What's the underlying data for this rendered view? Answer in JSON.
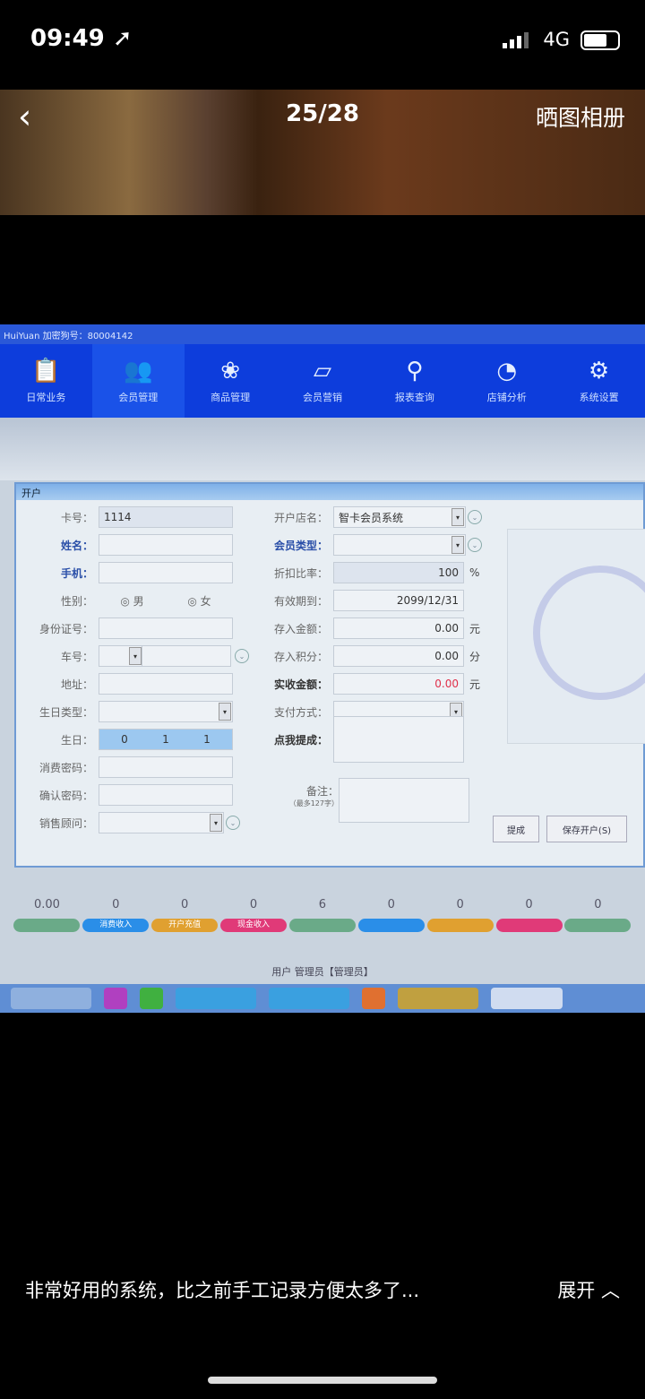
{
  "status_bar": {
    "time": "09:49",
    "network": "4G",
    "location_icon": "location-arrow-icon"
  },
  "viewer": {
    "counter": "25/28",
    "album_label": "晒图相册",
    "back_icon": "chevron-left-icon"
  },
  "app": {
    "title": "HuiYuan  加密狗号：80004142",
    "toolbar": [
      {
        "label": "日常业务",
        "icon": "clipboard-chart-icon"
      },
      {
        "label": "会员管理",
        "icon": "users-icon",
        "active": true
      },
      {
        "label": "商品管理",
        "icon": "cubes-icon"
      },
      {
        "label": "会员营销",
        "icon": "phone-icon"
      },
      {
        "label": "报表查询",
        "icon": "search-chart-icon"
      },
      {
        "label": "店铺分析",
        "icon": "pie-chart-icon"
      },
      {
        "label": "系统设置",
        "icon": "gear-icon"
      }
    ],
    "dialog": {
      "title": "开户",
      "left": {
        "card_no": {
          "label": "卡号：",
          "value": "1114"
        },
        "name": {
          "label": "姓名：",
          "value": ""
        },
        "mobile": {
          "label": "手机：",
          "value": ""
        },
        "gender": {
          "label": "性别：",
          "options": [
            "男",
            "女"
          ]
        },
        "id_no": {
          "label": "身份证号："
        },
        "car_no": {
          "label": "车号："
        },
        "address": {
          "label": "地址："
        },
        "birthday_type": {
          "label": "生日类型："
        },
        "birthday": {
          "label": "生日：",
          "values": [
            "0",
            "1",
            "1"
          ]
        },
        "pay_pwd": {
          "label": "消费密码："
        },
        "confirm_pwd": {
          "label": "确认密码："
        },
        "sales_advisor": {
          "label": "销售顾问："
        }
      },
      "right": {
        "store": {
          "label": "开户店名：",
          "value": "智卡会员系统"
        },
        "member_type": {
          "label": "会员类型：",
          "value": ""
        },
        "discount": {
          "label": "折扣比率：",
          "value": "100",
          "unit": "%"
        },
        "expiry": {
          "label": "有效期到：",
          "value": "2099/12/31"
        },
        "deposit": {
          "label": "存入金额：",
          "value": "0.00",
          "unit": "元"
        },
        "points": {
          "label": "存入积分：",
          "value": "0.00",
          "unit": "分"
        },
        "received": {
          "label": "实收金额：",
          "value": "0.00",
          "unit": "元",
          "color": "#e0304a"
        },
        "pay_method": {
          "label": "支付方式："
        },
        "commission": {
          "label": "点我提成："
        },
        "remark": {
          "label": "备注：",
          "hint": "（最多127字）"
        }
      },
      "buttons": [
        "提成",
        "保存开户(S)"
      ]
    },
    "stats": [
      {
        "value": "0.00",
        "label": "",
        "color": "#6aaa88"
      },
      {
        "value": "0",
        "label": "消费收入",
        "color": "#2a8ee8"
      },
      {
        "value": "0",
        "label": "开户充值",
        "color": "#e0a030"
      },
      {
        "value": "0",
        "label": "现金收入",
        "color": "#e03a78"
      },
      {
        "value": "6",
        "label": "",
        "color": "#6aaa88"
      },
      {
        "value": "0",
        "label": "",
        "color": "#2a8ee8"
      },
      {
        "value": "0",
        "label": "",
        "color": "#e0a030"
      },
      {
        "value": "0",
        "label": "",
        "color": "#e03a78"
      },
      {
        "value": "0",
        "label": "",
        "color": "#6aaa88"
      }
    ],
    "user_line": "用户  管理员【管理员】"
  },
  "caption": {
    "text": "非常好用的系统，比之前手工记录方便太多了...",
    "expand": "展开"
  }
}
